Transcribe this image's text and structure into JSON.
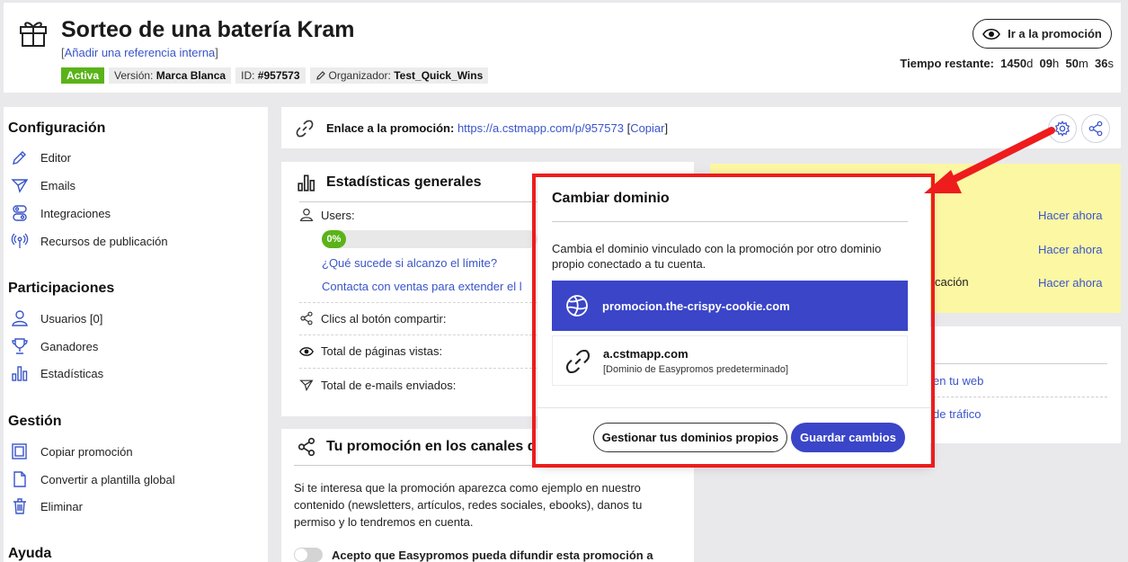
{
  "header": {
    "title": "Sorteo de una batería Kram",
    "ref_link": "Añadir una referencia interna",
    "badges": {
      "status": "Activa",
      "version_label": "Versión:",
      "version_value": "Marca Blanca",
      "id_label": "ID:",
      "id_value": "#957573",
      "organizer_label": "Organizador:",
      "organizer_value": "Test_Quick_Wins"
    },
    "go_button": "Ir a la promoción",
    "time": {
      "label": "Tiempo restante:",
      "days": "1450",
      "d": "d",
      "hours": "09",
      "h": "h",
      "minutes": "50",
      "m": "m",
      "seconds": "36",
      "s": "s"
    }
  },
  "sidebar": {
    "config_title": "Configuración",
    "config_items": [
      "Editor",
      "Emails",
      "Integraciones",
      "Recursos de publicación"
    ],
    "part_title": "Participaciones",
    "part_items": [
      "Usuarios [0]",
      "Ganadores",
      "Estadísticas"
    ],
    "gestion_title": "Gestión",
    "gestion_items": [
      "Copiar promoción",
      "Convertir a plantilla global",
      "Eliminar"
    ],
    "help_title": "Ayuda"
  },
  "linkbar": {
    "label": "Enlace a la promoción:",
    "url": "https://a.cstmapp.com/p/957573",
    "copy": "Copiar"
  },
  "stats": {
    "title": "Estadísticas generales",
    "users_label": "Users:",
    "progress_text": "0%",
    "progress": 0,
    "link_limit": "¿Qué sucede si alcanzo el límite?",
    "link_sales": "Contacta con ventas para extender el l",
    "shares": "Clics al botón compartir:",
    "views": "Total de páginas vistas:",
    "emails": "Total de e-mails enviados:"
  },
  "channels": {
    "title": "Tu promoción en los canales d",
    "text": "Si te interesa que la promoción aparezca como ejemplo en nuestro contenido (newsletters, artículos, redes sociales, ebooks), danos tu permiso y lo tendremos en cuenta.",
    "toggle_label": "Acepto que Easypromos pueda difundir esta promoción a"
  },
  "yellow": {
    "actions": [
      "Hacer ahora",
      "Hacer ahora",
      "Hacer ahora"
    ],
    "partial_text": "cación"
  },
  "rightwhite": {
    "link1": "en tu web",
    "link2": "de tráfico"
  },
  "modal": {
    "title": "Cambiar dominio",
    "description": "Cambia el dominio vinculado con la promoción por otro dominio propio conectado a tu cuenta.",
    "option1": "promocion.the-crispy-cookie.com",
    "option2_domain": "a.cstmapp.com",
    "option2_sub": "[Dominio de Easypromos predeterminado]",
    "manage_button": "Gestionar tus dominios propios",
    "save_button": "Guardar cambios"
  },
  "colors": {
    "accent": "#3a45c8",
    "link": "#3a55c9",
    "active_badge": "#5ab319",
    "annotation": "#ee1c1c",
    "notice": "#fbf7a3"
  }
}
